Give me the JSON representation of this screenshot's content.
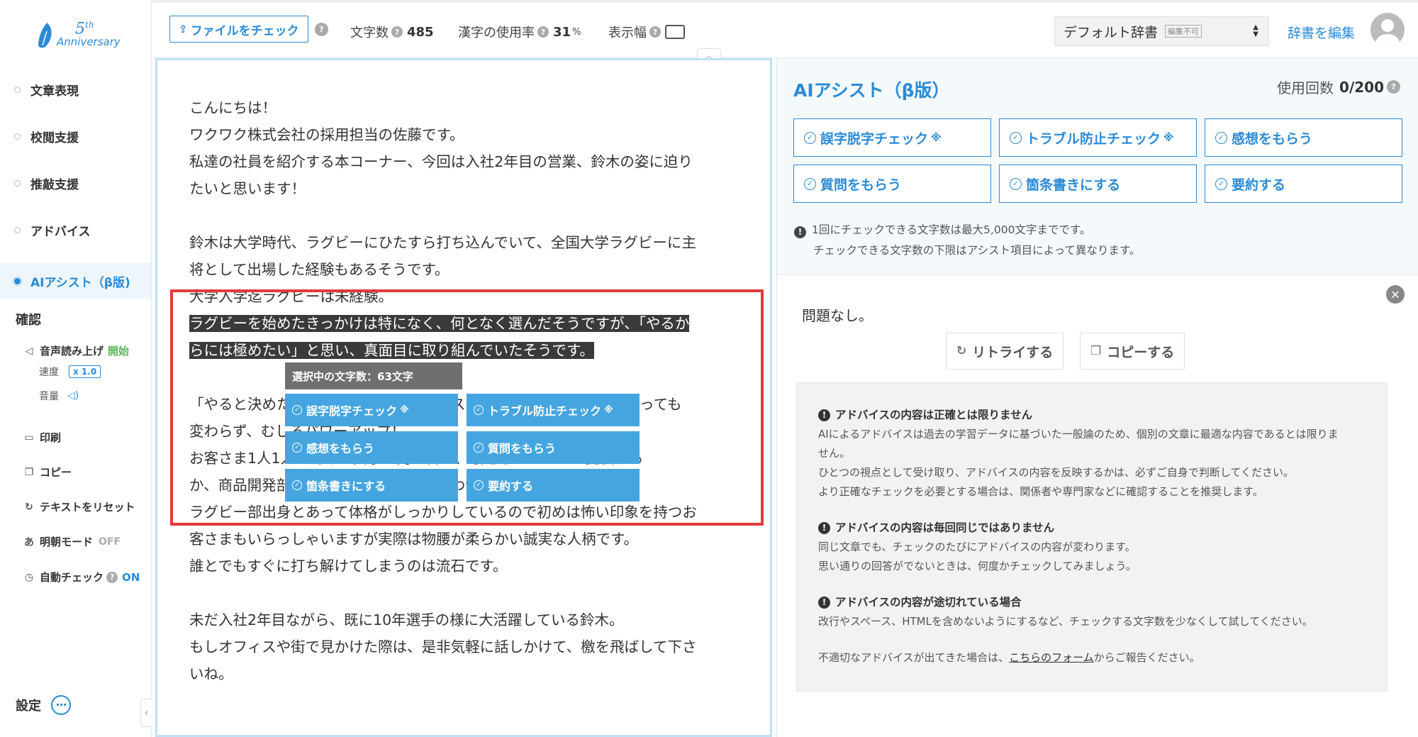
{
  "logo": {
    "number": "5",
    "suffix": "th",
    "text": "Anniversary"
  },
  "sidebar": {
    "items": [
      {
        "label": "文章表現"
      },
      {
        "label": "校閲支援"
      },
      {
        "label": "推敲支援"
      },
      {
        "label": "アドバイス"
      },
      {
        "label": "AIアシスト（β版)"
      }
    ],
    "confirm_title": "確認",
    "tts": {
      "label": "音声読み上げ",
      "action": "開始"
    },
    "speed": {
      "label": "速度",
      "value": "x 1.0"
    },
    "volume": {
      "label": "音量"
    },
    "print": "印刷",
    "copy": "コピー",
    "reset": "テキストをリセット",
    "mincho": {
      "label": "明朝モード",
      "state": "OFF"
    },
    "autocheck": {
      "label": "自動チェック",
      "state": "ON"
    },
    "settings": "設定"
  },
  "toolbar": {
    "file_check": "ファイルをチェック",
    "char_count_label": "文字数",
    "char_count": "485",
    "kanji_label": "漢字の使用率",
    "kanji_value": "31",
    "kanji_unit": "%",
    "width_label": "表示幅",
    "dictionary": "デフォルト辞書",
    "dictionary_tag": "編集不可",
    "edit_dict": "辞書を編集"
  },
  "editor": {
    "lines": [
      "こんにちは！",
      "ワクワク株式会社の採用担当の佐藤です。",
      "私達の社員を紹介する本コーナー、今回は入社2年目の営業、鈴木の姿に迫り",
      "たいと思います！",
      "",
      "鈴木は大学時代、ラグビーにひたすら打ち込んでいて、全国大学ラグビーに主",
      "将として出場した経験もあるそうです。",
      "大学入学迄ラグビーは未経験。"
    ],
    "highlight": [
      "ラグビーを始めたきっかけは特になく、何となく選んだそうですが、「やるか",
      "らには極めたい」と思い、真面目に取り組んでいたそうです。"
    ],
    "lines_after": [
      "",
      "「やると決めたことは打ち込む」というスタンス。姿勢は社会人になっても",
      "変わらず、むしろパワーアップ！",
      "お客さま1人1人に対して真摯に向き合い、最適なサービスを提供する",
      "か、商品開発部門の人間と何度も打ち合わせを重ねています。",
      "ラグビー部出身とあって体格がしっかりしているので初めは怖い印象を持つお",
      "客さまもいらっしゃいますが実際は物腰が柔らかい誠実な人柄です。",
      "誰とでもすぐに打ち解けてしまうのは流石です。",
      "",
      "未だ入社2年目ながら、既に10年選手の様に大活躍している鈴木。",
      "もしオフィスや街で見かけた際は、是非気軽に話しかけて、檄を飛ばして下さ",
      "いね。"
    ],
    "selection_count": "選択中の文字数：63文字",
    "popup_buttons": [
      {
        "label": "誤字脱字チェック",
        "star": "※"
      },
      {
        "label": "トラブル防止チェック",
        "star": "※"
      },
      {
        "label": "感想をもらう",
        "star": ""
      },
      {
        "label": "質問をもらう",
        "star": ""
      },
      {
        "label": "箇条書きにする",
        "star": ""
      },
      {
        "label": "要約する",
        "star": ""
      }
    ]
  },
  "ai_panel": {
    "title": "AIアシスト（β版）",
    "usage_label": "使用回数",
    "usage_value": "0/200",
    "buttons": [
      {
        "label": "誤字脱字チェック",
        "star": "※"
      },
      {
        "label": "トラブル防止チェック",
        "star": "※"
      },
      {
        "label": "感想をもらう",
        "star": ""
      },
      {
        "label": "質問をもらう",
        "star": ""
      },
      {
        "label": "箇条書きにする",
        "star": ""
      },
      {
        "label": "要約する",
        "star": ""
      }
    ],
    "note_line1": "1回にチェックできる文字数は最大5,000文字までです。",
    "note_line2": "チェックできる文字数の下限はアシスト項目によって異なります。",
    "result": "問題なし。",
    "retry": "リトライする",
    "copy": "コピーする",
    "disclaimer": {
      "h1": "アドバイスの内容は正確とは限りません",
      "p1a": "AIによるアドバイスは過去の学習データに基づいた一般論のため、個別の文章に最適な内容であるとは限りま",
      "p1b": "せん。",
      "p1c": "ひとつの視点として受け取り、アドバイスの内容を反映するかは、必ずご自身で判断してください。",
      "p1d": "より正確なチェックを必要とする場合は、関係者や専門家などに確認することを推奨します。",
      "h2": "アドバイスの内容は毎回同じではありません",
      "p2a": "同じ文章でも、チェックのたびにアドバイスの内容が変わります。",
      "p2b": "思い通りの回答がでないときは、何度かチェックしてみましょう。",
      "h3": "アドバイスの内容が途切れている場合",
      "p3a": "改行やスペース、HTMLを含めないようにするなど、チェックする文字数を少なくして試してください。",
      "p4_pre": "不適切なアドバイスが出てきた場合は、",
      "p4_link": "こちらのフォーム",
      "p4_post": "からご報告ください。"
    }
  },
  "colors": {
    "accent": "#2b8bd6",
    "popup": "#45a5e0",
    "frame": "#e03b3b",
    "highlight": "#3a3a3a"
  }
}
